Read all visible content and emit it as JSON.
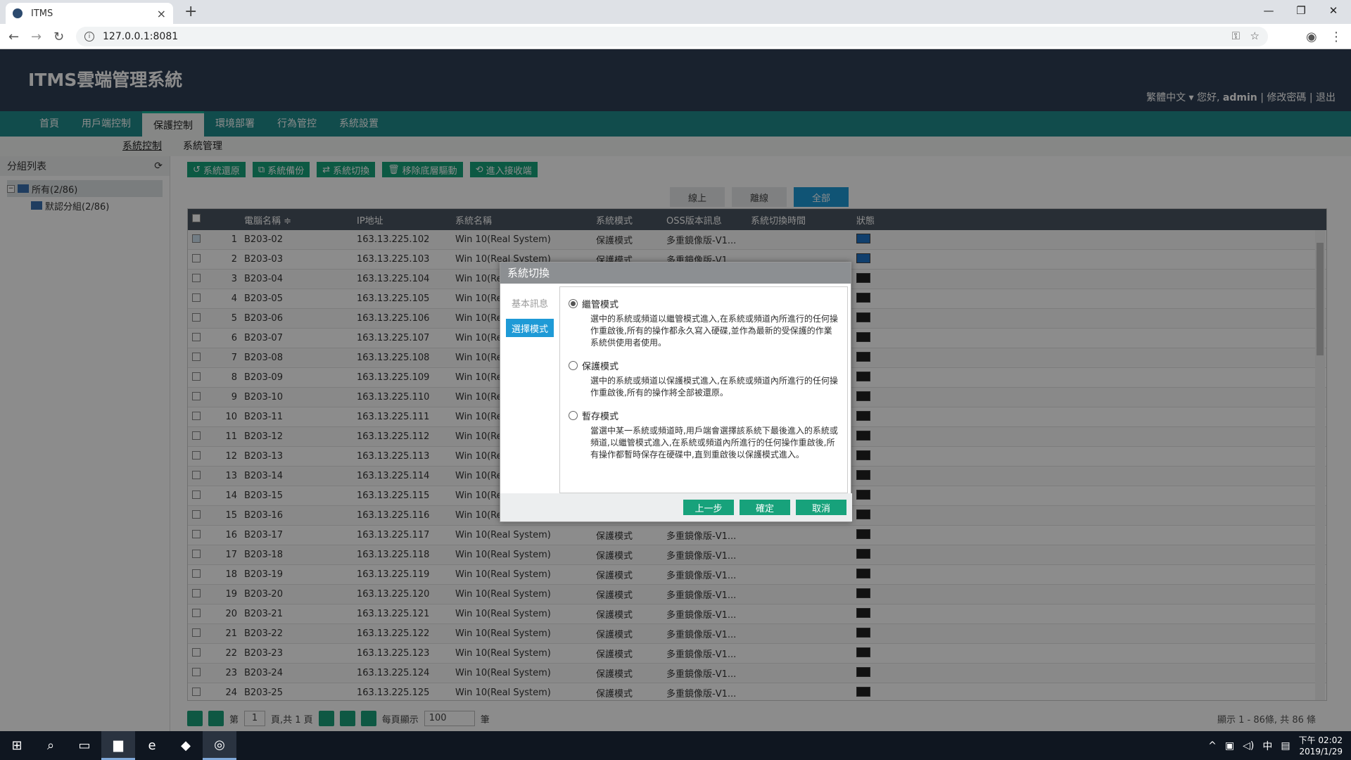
{
  "browser": {
    "tab_title": "ITMS",
    "url": "127.0.0.1:8081"
  },
  "app": {
    "logo": "ITMS雲端管理系統",
    "language": "繁體中文",
    "greeting": "您好,",
    "username": "admin",
    "change_password": "修改密碼",
    "logout": "退出",
    "separator": "|"
  },
  "mainnav": [
    "首頁",
    "用戶端控制",
    "保護控制",
    "環境部署",
    "行為管控",
    "系統設置"
  ],
  "subnav": [
    "系統控制",
    "系統管理"
  ],
  "sidebar": {
    "title": "分組列表",
    "root": "所有(2/86)",
    "child": "默認分組(2/86)"
  },
  "toolbar": [
    "系統還原",
    "系統備份",
    "系統切換",
    "移除底層驅動",
    "進入接收端"
  ],
  "filters": [
    "線上",
    "離線",
    "全部"
  ],
  "grid": {
    "headers": [
      "電腦名稱 ≑",
      "IP地址",
      "系統名稱",
      "系統模式",
      "OSS版本訊息",
      "系統切換時間",
      "狀態"
    ],
    "rows": [
      [
        "1",
        "B203-02",
        "163.13.225.102",
        "Win 10(Real System)",
        "保護模式",
        "多重鏡像版-V1..."
      ],
      [
        "2",
        "B203-03",
        "163.13.225.103",
        "Win 10(Real System)",
        "保護模式",
        "多重鏡像版-V1..."
      ],
      [
        "3",
        "B203-04",
        "163.13.225.104",
        "Win 10(Re",
        "",
        ""
      ],
      [
        "4",
        "B203-05",
        "163.13.225.105",
        "Win 10(Re",
        "",
        ""
      ],
      [
        "5",
        "B203-06",
        "163.13.225.106",
        "Win 10(Re",
        "",
        ""
      ],
      [
        "6",
        "B203-07",
        "163.13.225.107",
        "Win 10(Re",
        "",
        ""
      ],
      [
        "7",
        "B203-08",
        "163.13.225.108",
        "Win 10(Re",
        "",
        ""
      ],
      [
        "8",
        "B203-09",
        "163.13.225.109",
        "Win 10(Re",
        "",
        ""
      ],
      [
        "9",
        "B203-10",
        "163.13.225.110",
        "Win 10(Re",
        "",
        ""
      ],
      [
        "10",
        "B203-11",
        "163.13.225.111",
        "Win 10(Re",
        "",
        ""
      ],
      [
        "11",
        "B203-12",
        "163.13.225.112",
        "Win 10(Re",
        "",
        ""
      ],
      [
        "12",
        "B203-13",
        "163.13.225.113",
        "Win 10(Re",
        "",
        ""
      ],
      [
        "13",
        "B203-14",
        "163.13.225.114",
        "Win 10(Re",
        "",
        ""
      ],
      [
        "14",
        "B203-15",
        "163.13.225.115",
        "Win 10(Re",
        "",
        ""
      ],
      [
        "15",
        "B203-16",
        "163.13.225.116",
        "Win 10(Re",
        "",
        ""
      ],
      [
        "16",
        "B203-17",
        "163.13.225.117",
        "Win 10(Real System)",
        "保護模式",
        "多重鏡像版-V1..."
      ],
      [
        "17",
        "B203-18",
        "163.13.225.118",
        "Win 10(Real System)",
        "保護模式",
        "多重鏡像版-V1..."
      ],
      [
        "18",
        "B203-19",
        "163.13.225.119",
        "Win 10(Real System)",
        "保護模式",
        "多重鏡像版-V1..."
      ],
      [
        "19",
        "B203-20",
        "163.13.225.120",
        "Win 10(Real System)",
        "保護模式",
        "多重鏡像版-V1..."
      ],
      [
        "20",
        "B203-21",
        "163.13.225.121",
        "Win 10(Real System)",
        "保護模式",
        "多重鏡像版-V1..."
      ],
      [
        "21",
        "B203-22",
        "163.13.225.122",
        "Win 10(Real System)",
        "保護模式",
        "多重鏡像版-V1..."
      ],
      [
        "22",
        "B203-23",
        "163.13.225.123",
        "Win 10(Real System)",
        "保護模式",
        "多重鏡像版-V1..."
      ],
      [
        "23",
        "B203-24",
        "163.13.225.124",
        "Win 10(Real System)",
        "保護模式",
        "多重鏡像版-V1..."
      ],
      [
        "24",
        "B203-25",
        "163.13.225.125",
        "Win 10(Real System)",
        "保護模式",
        "多重鏡像版-V1..."
      ]
    ]
  },
  "pager": {
    "page_label": "第",
    "page_value": "1",
    "page_total": "頁,共 1 頁",
    "per_page_label": "每頁顯示",
    "per_page_value": "100",
    "per_page_unit": "筆",
    "info": "顯示 1 - 86條, 共 86 條"
  },
  "modal": {
    "title": "系統切換",
    "steps": [
      "基本訊息",
      "選擇模式"
    ],
    "options": [
      {
        "label": "繼管模式",
        "desc": "選中的系統或頻道以繼管模式進入,在系統或頻道內所進行的任何操作重啟後,所有的操作都永久寫入硬碟,並作為最新的受保護的作業系統供使用者使用。"
      },
      {
        "label": "保護模式",
        "desc": "選中的系統或頻道以保護模式進入,在系統或頻道內所進行的任何操作重啟後,所有的操作將全部被還原。"
      },
      {
        "label": "暫存模式",
        "desc": "當選中某一系統或頻道時,用戶端會選擇該系統下最後進入的系統或頻道,以繼管模式進入,在系統或頻道內所進行的任何操作重啟後,所有操作都暫時保存在硬碟中,直到重啟後以保護模式進入。"
      }
    ],
    "buttons": {
      "prev": "上一步",
      "ok": "確定",
      "cancel": "取消"
    }
  },
  "taskbar": {
    "ime": "中",
    "time": "下午 02:02",
    "date": "2019/1/29"
  }
}
